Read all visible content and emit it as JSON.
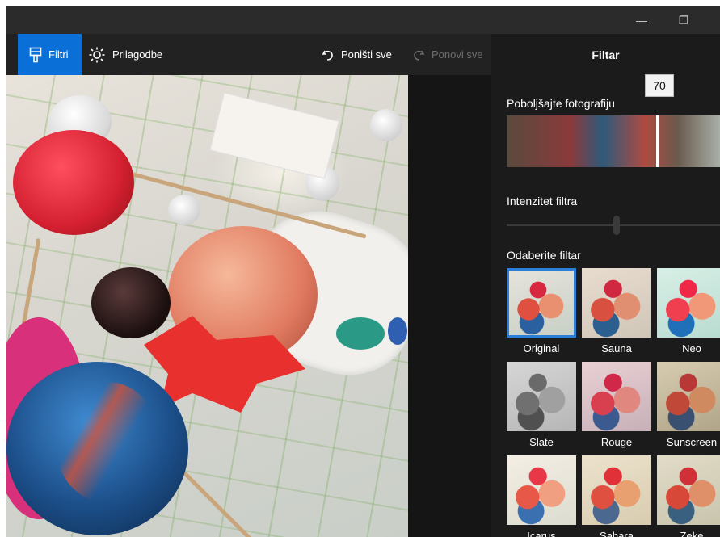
{
  "titlebar": {
    "minimize_icon": "minimize-icon",
    "maximize_icon": "restore-icon",
    "close_icon": "close-icon"
  },
  "toolbar": {
    "filters_label": "Filtri",
    "adjust_label": "Prilagodbe",
    "undo_label": "Poništi sve",
    "redo_label": "Ponovi sve"
  },
  "panel": {
    "title": "Filtar",
    "enhance_label": "Poboljšajte fotografiju",
    "enhance_value": "70",
    "intensity_label": "Intenzitet filtra",
    "choose_label": "Odaberite filtar",
    "filters": [
      {
        "name": "Original",
        "selected": true
      },
      {
        "name": "Sauna"
      },
      {
        "name": "Neo"
      },
      {
        "name": "Slate"
      },
      {
        "name": "Rouge"
      },
      {
        "name": "Sunscreen"
      },
      {
        "name": "Icarus"
      },
      {
        "name": "Sahara"
      },
      {
        "name": "Zeke"
      }
    ]
  },
  "colors": {
    "accent": "#0a6fd6",
    "background": "#1e1e1e",
    "panel": "#1b1b1b"
  }
}
